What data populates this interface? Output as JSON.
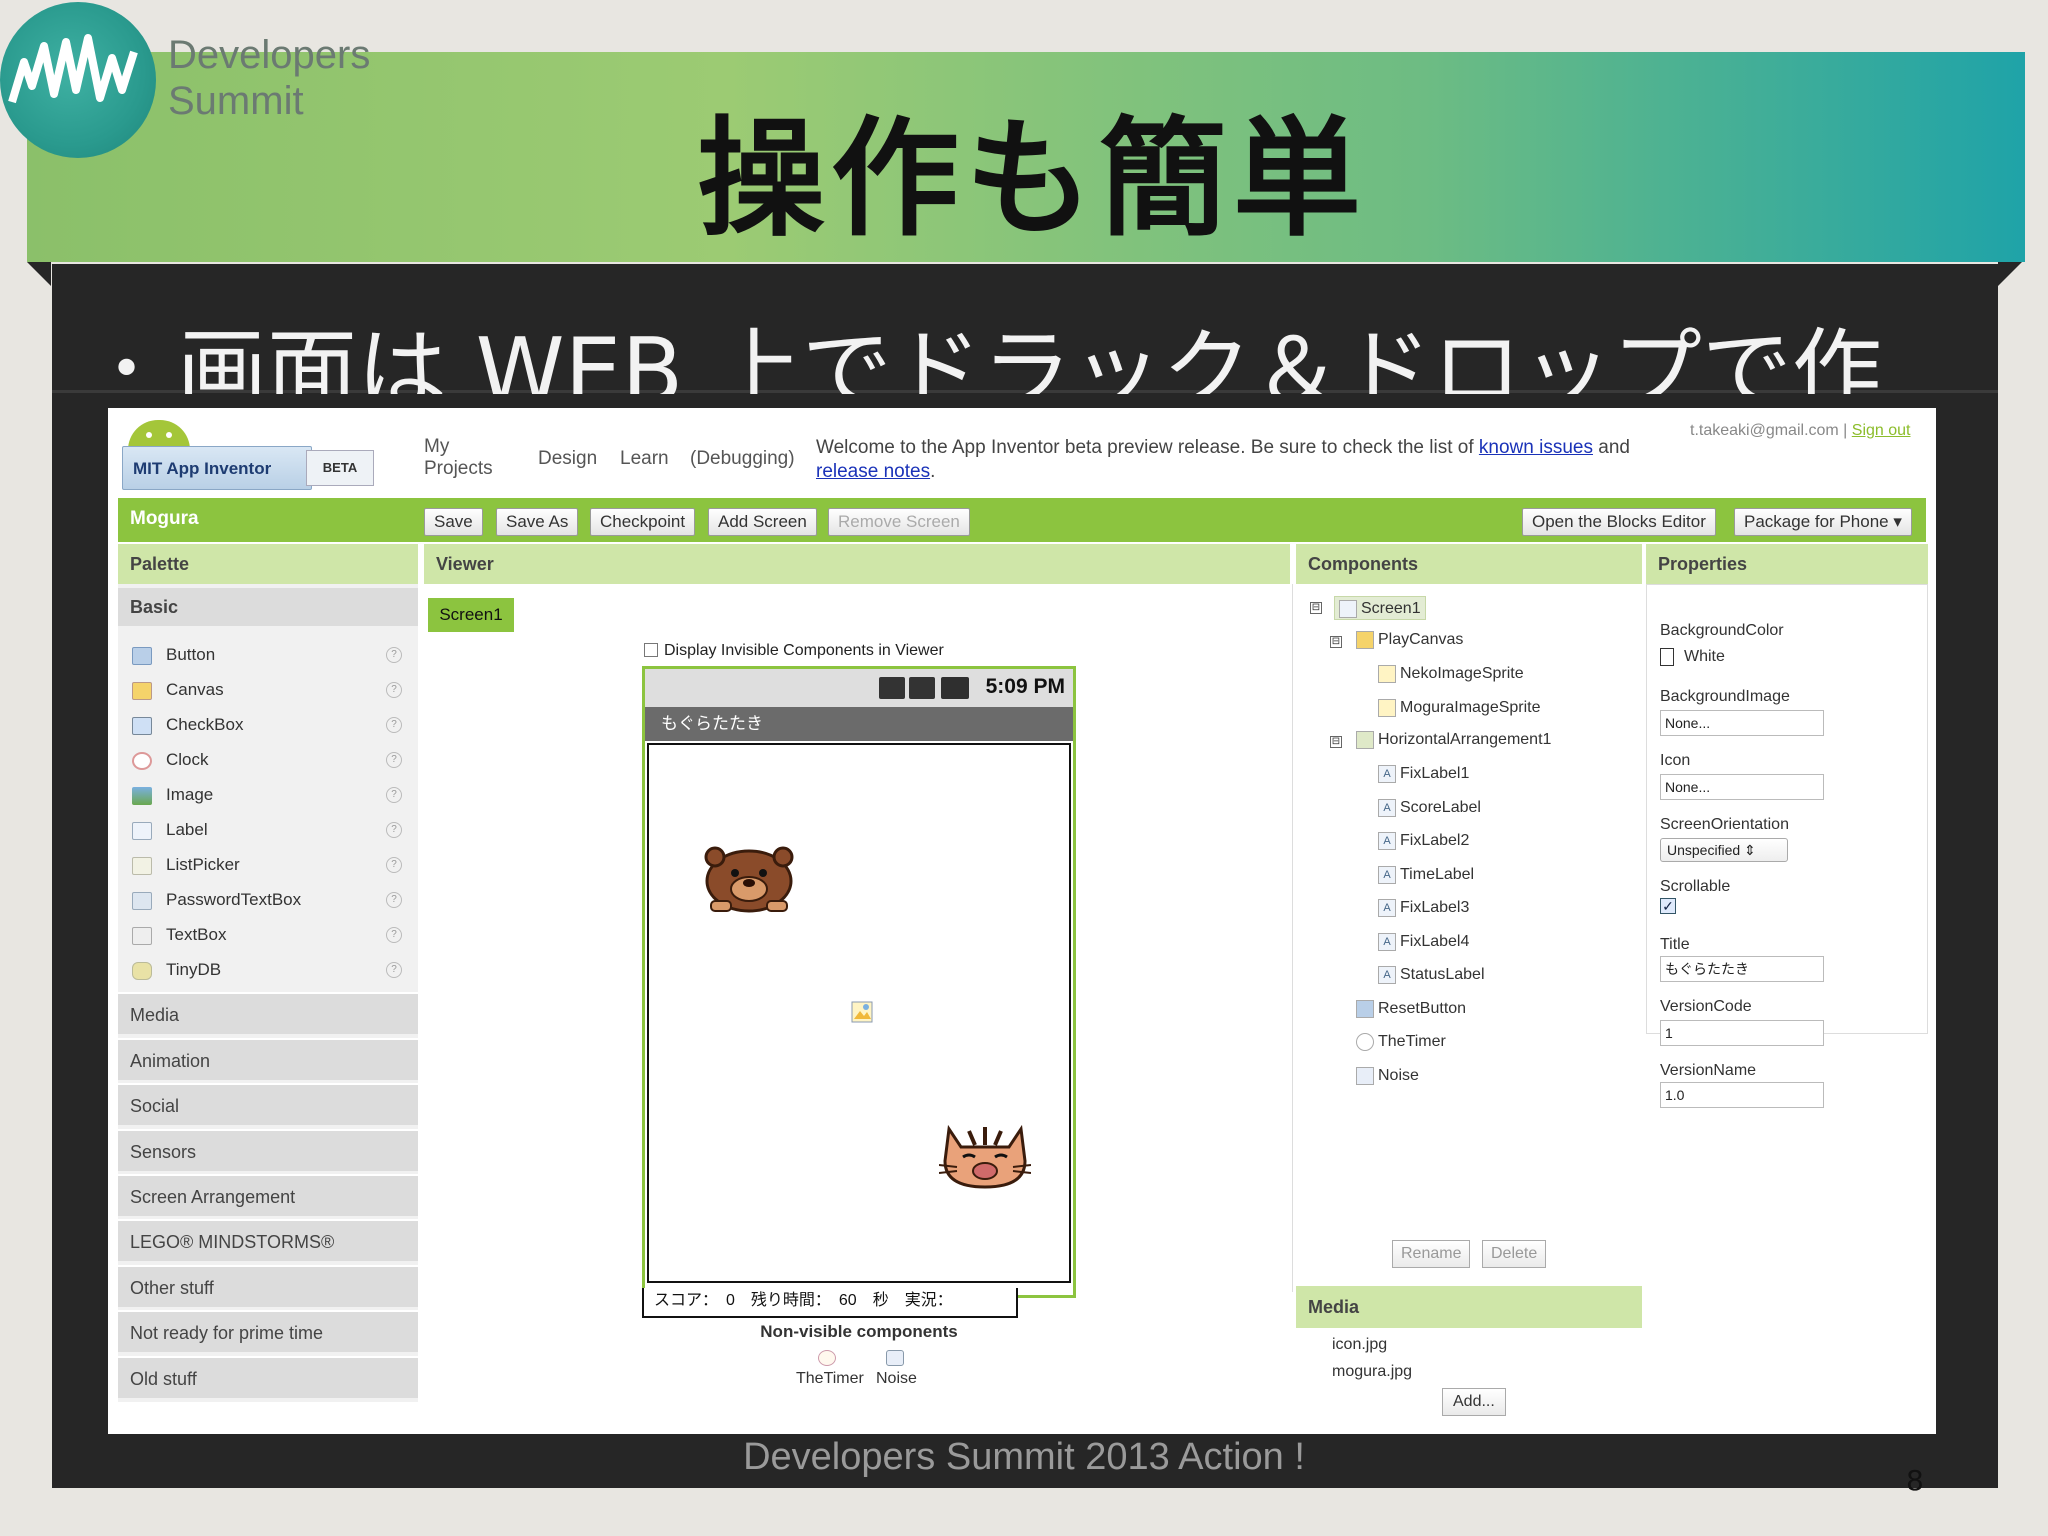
{
  "slide": {
    "title": "操作も簡単",
    "logo_line1": "Developers",
    "logo_line2": "Summit",
    "bullet": "画面は WEB 上でドラック＆ドロップで作",
    "bullet_mark": "•",
    "footer": "Developers Summit 2013 Action !",
    "page_number": "8"
  },
  "app": {
    "logo_name": "MIT App Inventor",
    "beta": "BETA",
    "nav": {
      "my_projects_1": "My",
      "my_projects_2": "Projects",
      "design": "Design",
      "learn": "Learn",
      "debugging": "(Debugging)"
    },
    "welcome_1": "Welcome to the App Inventor beta preview release. Be sure to check the list of ",
    "known_issues": "known issues",
    "welcome_2": " and ",
    "release_notes": "release notes",
    "welcome_3": ".",
    "account": "t.takeaki@gmail.com",
    "account_sep": " | ",
    "sign_out": "Sign out"
  },
  "toolbar": {
    "project_name": "Mogura",
    "save": "Save",
    "save_as": "Save As",
    "checkpoint": "Checkpoint",
    "add_screen": "Add Screen",
    "remove_screen": "Remove Screen",
    "open_blocks": "Open the Blocks Editor",
    "package": "Package for Phone ▾"
  },
  "palette": {
    "header": "Palette",
    "basic": "Basic",
    "items": [
      "Button",
      "Canvas",
      "CheckBox",
      "Clock",
      "Image",
      "Label",
      "ListPicker",
      "PasswordTextBox",
      "TextBox",
      "TinyDB"
    ],
    "groups": [
      "Media",
      "Animation",
      "Social",
      "Sensors",
      "Screen Arrangement",
      "LEGO® MINDSTORMS®",
      "Other stuff",
      "Not ready for prime time",
      "Old stuff"
    ],
    "help": "?"
  },
  "viewer": {
    "header": "Viewer",
    "screen_tab": "Screen1",
    "display_invisible": "Display Invisible Components in Viewer",
    "time": "5:09 PM",
    "app_title": "もぐらたたき",
    "score_bar": "スコア：　0　残り時間：　60　秒　実況：",
    "nonvisible_title": "Non-visible components",
    "nonvisible": [
      "TheTimer",
      "Noise"
    ]
  },
  "components": {
    "header": "Components",
    "tree": [
      {
        "label": "Screen1"
      },
      {
        "label": "PlayCanvas"
      },
      {
        "label": "NekoImageSprite"
      },
      {
        "label": "MoguraImageSprite"
      },
      {
        "label": "HorizontalArrangement1"
      },
      {
        "label": "FixLabel1"
      },
      {
        "label": "ScoreLabel"
      },
      {
        "label": "FixLabel2"
      },
      {
        "label": "TimeLabel"
      },
      {
        "label": "FixLabel3"
      },
      {
        "label": "FixLabel4"
      },
      {
        "label": "StatusLabel"
      },
      {
        "label": "ResetButton"
      },
      {
        "label": "TheTimer"
      },
      {
        "label": "Noise"
      }
    ],
    "rename": "Rename",
    "delete": "Delete",
    "toggle": "⊟"
  },
  "media": {
    "header": "Media",
    "files": [
      "icon.jpg",
      "mogura.jpg"
    ],
    "add": "Add..."
  },
  "properties": {
    "header": "Properties",
    "background_color_label": "BackgroundColor",
    "background_color_value": "White",
    "background_image_label": "BackgroundImage",
    "background_image_value": "None...",
    "icon_label": "Icon",
    "icon_value": "None...",
    "orientation_label": "ScreenOrientation",
    "orientation_value": "Unspecified  ⇕",
    "scrollable_label": "Scrollable",
    "scrollable_checked": true,
    "title_label": "Title",
    "title_value": "もぐらたたき",
    "version_code_label": "VersionCode",
    "version_code_value": "1",
    "version_name_label": "VersionName",
    "version_name_value": "1.0"
  },
  "colors": {
    "accent_green": "#8cc43f",
    "panel_header": "#cfe6a8",
    "slide_dark": "#262626"
  }
}
